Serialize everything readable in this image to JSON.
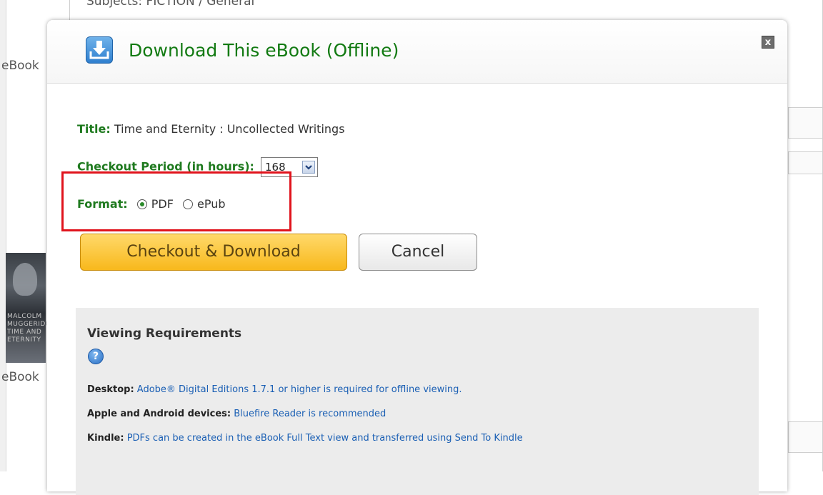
{
  "background": {
    "subjects_text": "Subjects: FICTION / General",
    "ebook_label_1": "eBook",
    "ebook_label_2": "eBook",
    "cover_text": "MALCOLM MUGGERIDGE TIME AND ETERNITY"
  },
  "dialog": {
    "title": "Download This eBook (Offline)",
    "close_label": "x",
    "title_field": {
      "label": "Title:",
      "value": "Time and Eternity : Uncollected Writings"
    },
    "checkout_period": {
      "label": "Checkout Period (in hours):",
      "selected": "168"
    },
    "format": {
      "label": "Format:",
      "options": [
        {
          "label": "PDF",
          "selected": true
        },
        {
          "label": "ePub",
          "selected": false
        }
      ]
    },
    "buttons": {
      "checkout": "Checkout & Download",
      "cancel": "Cancel"
    },
    "requirements": {
      "heading": "Viewing Requirements",
      "help_glyph": "?",
      "lines": [
        {
          "key": "Desktop:",
          "text": "Adobe® Digital Editions 1.7.1 or higher is required for offline viewing."
        },
        {
          "key": "Apple and Android devices:",
          "text": "Bluefire Reader is recommended"
        },
        {
          "key": "Kindle:",
          "text": "PDFs can be created in the eBook Full Text view and transferred using Send To Kindle"
        }
      ]
    }
  },
  "colors": {
    "label_green": "#1f7a1f",
    "title_green": "#127a12",
    "link_blue": "#1a5fb4",
    "highlight_red": "#e0131c",
    "checkout_yellow": "#f8b81c"
  }
}
